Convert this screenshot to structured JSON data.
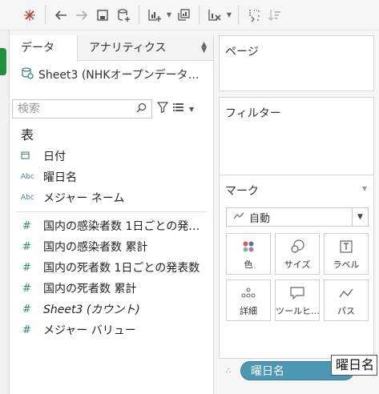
{
  "toolbar": {
    "icons": [
      "tableau-logo-icon",
      "back-arrow-icon",
      "forward-arrow-icon",
      "save-icon",
      "add-datasource-icon",
      "new-worksheet-icon",
      "duplicate-icon",
      "clear-sheet-icon",
      "swap-icon",
      "sort-icon"
    ]
  },
  "data_pane": {
    "tabs": [
      {
        "label": "データ"
      },
      {
        "label": "アナリティクス"
      }
    ],
    "datasource": "Sheet3 (NHKオープンデータ…",
    "search": {
      "placeholder": "検索",
      "value": ""
    },
    "section_title": "表",
    "dimensions": [
      {
        "type": "date",
        "icon": "calendar-icon",
        "label": "日付"
      },
      {
        "type": "Abc",
        "icon": "string-icon",
        "label": "曜日名"
      },
      {
        "type": "Abc",
        "icon": "string-icon",
        "label": "メジャー ネーム"
      }
    ],
    "measures": [
      {
        "type": "#",
        "label": "国内の感染者数 1日ごとの発…"
      },
      {
        "type": "#",
        "label": "国内の感染者数 累計"
      },
      {
        "type": "#",
        "label": "国内の死者数 1日ごとの発表数"
      },
      {
        "type": "#",
        "label": "国内の死者数 累計"
      },
      {
        "type": "#",
        "label": "Sheet3 (カウント)",
        "italic": true
      },
      {
        "type": "#",
        "label": "メジャー バリュー"
      }
    ]
  },
  "cards": {
    "pages_title": "ページ",
    "filters_title": "フィルター",
    "marks_title": "マーク",
    "mark_type": "自動",
    "mark_buttons": [
      {
        "label": "色",
        "icon": "color-icon"
      },
      {
        "label": "サイズ",
        "icon": "size-icon"
      },
      {
        "label": "ラベル",
        "icon": "label-icon"
      },
      {
        "label": "詳細",
        "icon": "detail-icon"
      },
      {
        "label": "ツールヒ…",
        "icon": "tooltip-icon"
      },
      {
        "label": "パス",
        "icon": "path-icon"
      }
    ],
    "pill": "曜日名"
  },
  "tooltip": "曜日名",
  "colors": {
    "pill": "#4b97b4",
    "measure_icon": "#2e8b79",
    "dimension_icon": "#4e7aa3"
  }
}
